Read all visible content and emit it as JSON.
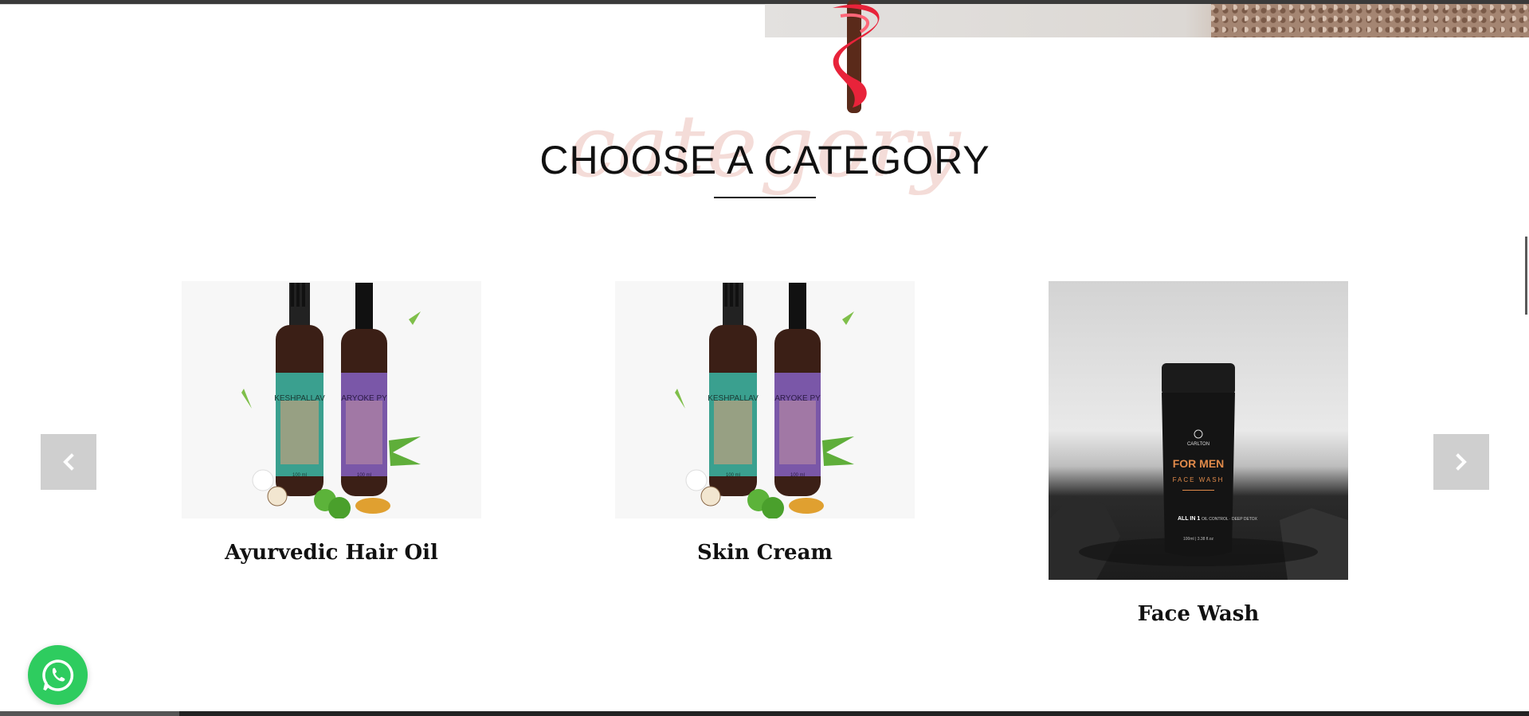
{
  "header": {
    "script_word": "category",
    "title": "CHOOSE A CATEGORY"
  },
  "carousel": {
    "prev_icon": "chevron-left-icon",
    "next_icon": "chevron-right-icon",
    "items": [
      {
        "label": "Ayurvedic Hair Oil",
        "image": "hair-oil-bottles"
      },
      {
        "label": "Skin Cream",
        "image": "hair-oil-bottles"
      },
      {
        "label": "Face Wash",
        "image": "men-face-wash-bottle"
      }
    ]
  },
  "products": {
    "bottle_left_text": "KESHPALLAV",
    "bottle_right_text": "ARYOKE PY",
    "bottle_volume": "100 ml",
    "facewash_brand": "CARLTON",
    "facewash_line1": "FOR MEN",
    "facewash_line2": "FACE WASH",
    "facewash_badge": "ALL IN 1",
    "facewash_features": "OIL CONTROL · DEEP DETOX",
    "facewash_volume": "100ml | 3.38 fl.oz"
  },
  "floating": {
    "whatsapp_icon": "whatsapp-icon"
  },
  "colors": {
    "accent_pink": "#f4dcd8",
    "whatsapp_green": "#2ecc5f",
    "button_gray": "#cfcfcf"
  }
}
